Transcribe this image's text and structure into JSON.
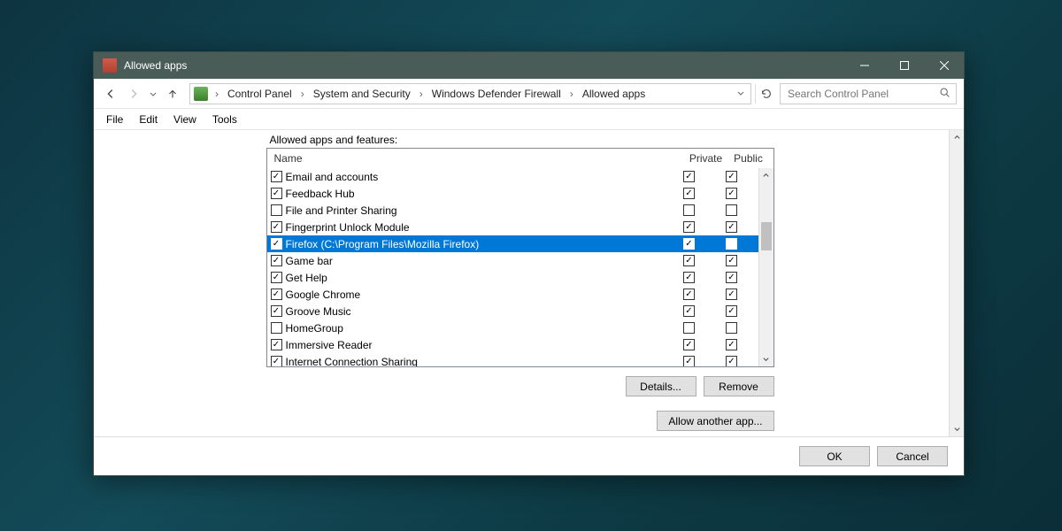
{
  "window": {
    "title": "Allowed apps"
  },
  "breadcrumb": {
    "items": [
      "Control Panel",
      "System and Security",
      "Windows Defender Firewall",
      "Allowed apps"
    ]
  },
  "search": {
    "placeholder": "Search Control Panel"
  },
  "menubar": {
    "items": [
      "File",
      "Edit",
      "View",
      "Tools"
    ]
  },
  "section": {
    "label": "Allowed apps and features:"
  },
  "columns": {
    "name": "Name",
    "private": "Private",
    "public": "Public"
  },
  "rows": [
    {
      "name": "Email and accounts",
      "enabled": true,
      "private": true,
      "public": true,
      "selected": false
    },
    {
      "name": "Feedback Hub",
      "enabled": true,
      "private": true,
      "public": true,
      "selected": false
    },
    {
      "name": "File and Printer Sharing",
      "enabled": false,
      "private": false,
      "public": false,
      "selected": false
    },
    {
      "name": "Fingerprint Unlock Module",
      "enabled": true,
      "private": true,
      "public": true,
      "selected": false
    },
    {
      "name": "Firefox (C:\\Program Files\\Mozilla Firefox)",
      "enabled": true,
      "private": true,
      "public": false,
      "selected": true
    },
    {
      "name": "Game bar",
      "enabled": true,
      "private": true,
      "public": true,
      "selected": false
    },
    {
      "name": "Get Help",
      "enabled": true,
      "private": true,
      "public": true,
      "selected": false
    },
    {
      "name": "Google Chrome",
      "enabled": true,
      "private": true,
      "public": true,
      "selected": false
    },
    {
      "name": "Groove Music",
      "enabled": true,
      "private": true,
      "public": true,
      "selected": false
    },
    {
      "name": "HomeGroup",
      "enabled": false,
      "private": false,
      "public": false,
      "selected": false
    },
    {
      "name": "Immersive Reader",
      "enabled": true,
      "private": true,
      "public": true,
      "selected": false
    },
    {
      "name": "Internet Connection Sharing",
      "enabled": true,
      "private": true,
      "public": true,
      "selected": false
    }
  ],
  "buttons": {
    "details": "Details...",
    "remove": "Remove",
    "allow_another": "Allow another app...",
    "ok": "OK",
    "cancel": "Cancel"
  }
}
